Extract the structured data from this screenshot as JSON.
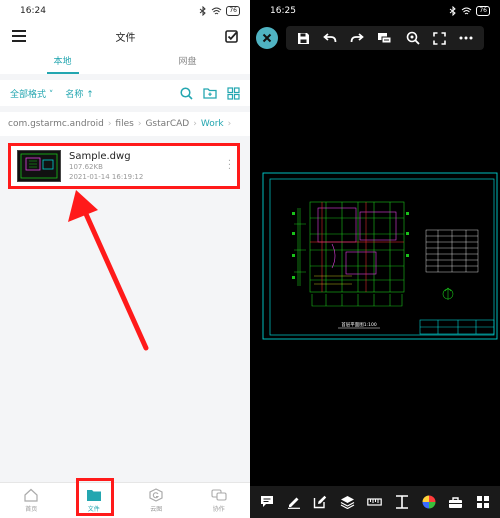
{
  "left": {
    "status": {
      "time": "16:24",
      "battery": "76"
    },
    "header": {
      "title": "文件"
    },
    "tabs": [
      {
        "label": "本地"
      },
      {
        "label": "网盘"
      }
    ],
    "filter": {
      "format": "全部格式",
      "sort": "名称 ↑"
    },
    "breadcrumb": [
      "com.gstarmc.android",
      "files",
      "GstarCAD",
      "Work"
    ],
    "file": {
      "name": "Sample.dwg",
      "size": "107.62KB",
      "date": "2021-01-14 16:19:12"
    },
    "nav": [
      {
        "label": "首页"
      },
      {
        "label": "文件"
      },
      {
        "label": "云图"
      },
      {
        "label": "协作"
      }
    ]
  },
  "right": {
    "status": {
      "time": "16:25",
      "battery": "76"
    },
    "drawing": {
      "caption": "首层平面图1:100"
    }
  },
  "colors": {
    "accent": "#23a6b0",
    "highlight": "#ff1a1a",
    "cad_cyan": "#00d0d0",
    "cad_green": "#19c219",
    "cad_magenta": "#e040e0"
  }
}
